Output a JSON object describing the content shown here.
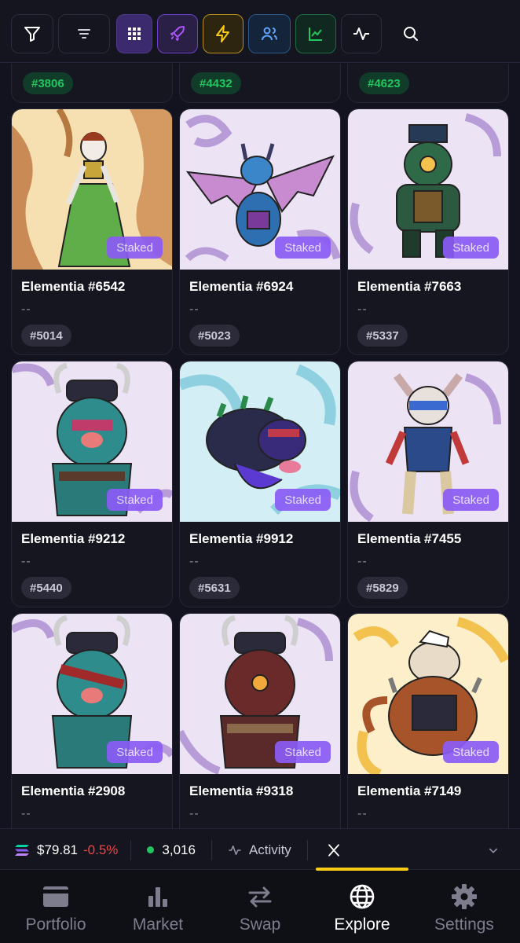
{
  "toolbar": {
    "buttons": [
      {
        "name": "filter-button",
        "icon": "filter-icon"
      },
      {
        "name": "sort-button",
        "icon": "sort-lines-icon"
      },
      {
        "name": "grid-view-button",
        "icon": "grid-icon",
        "color": "#8b5cf6"
      },
      {
        "name": "rocket-button",
        "icon": "rocket-icon",
        "color": "#a855f7"
      },
      {
        "name": "lightning-button",
        "icon": "lightning-icon",
        "color": "#facc15"
      },
      {
        "name": "users-button",
        "icon": "users-icon",
        "color": "#60a5fa"
      },
      {
        "name": "chart-button",
        "icon": "line-chart-icon",
        "color": "#22c55e"
      },
      {
        "name": "activity-button",
        "icon": "activity-pulse-icon"
      },
      {
        "name": "search-button",
        "icon": "search-icon"
      }
    ]
  },
  "partial_row": {
    "ranks": [
      "#3806",
      "#4432",
      "#4623"
    ]
  },
  "cards": [
    {
      "name": "Elementia #6542",
      "price": "--",
      "rank": "#5014",
      "badge": "Staked",
      "bg": "#f6dfb1"
    },
    {
      "name": "Elementia #6924",
      "price": "--",
      "rank": "#5023",
      "badge": "Staked",
      "bg": "#ece3f5"
    },
    {
      "name": "Elementia #7663",
      "price": "--",
      "rank": "#5337",
      "badge": "Staked",
      "bg": "#ece3f5"
    },
    {
      "name": "Elementia #9212",
      "price": "--",
      "rank": "#5440",
      "badge": "Staked",
      "bg": "#ece3f5"
    },
    {
      "name": "Elementia #9912",
      "price": "--",
      "rank": "#5631",
      "badge": "Staked",
      "bg": "#d3eff5"
    },
    {
      "name": "Elementia #7455",
      "price": "--",
      "rank": "#5829",
      "badge": "Staked",
      "bg": "#ece3f5"
    },
    {
      "name": "Elementia #2908",
      "price": "--",
      "badge": "Staked",
      "bg": "#ece3f5"
    },
    {
      "name": "Elementia #9318",
      "price": "--",
      "badge": "Staked",
      "bg": "#ece3f5"
    },
    {
      "name": "Elementia #7149",
      "price": "--",
      "badge": "Staked",
      "bg": "#fcefc9"
    }
  ],
  "statusbar": {
    "sol_price": "$79.81",
    "sol_change": "-0.5%",
    "sol_change_color": "#ef4444",
    "online_count": "3,016",
    "online_color": "#22c55e",
    "activity_label": "Activity",
    "x_icon": "x-logo-icon",
    "expand_icon": "chevron-down-icon"
  },
  "bottomnav": {
    "items": [
      {
        "label": "Portfolio",
        "icon": "wallet-icon",
        "active": false
      },
      {
        "label": "Market",
        "icon": "bar-chart-icon",
        "active": false
      },
      {
        "label": "Swap",
        "icon": "swap-arrows-icon",
        "active": false
      },
      {
        "label": "Explore",
        "icon": "globe-icon",
        "active": true
      },
      {
        "label": "Settings",
        "icon": "gear-icon",
        "active": false
      }
    ],
    "indicator_color": "#facc15"
  }
}
